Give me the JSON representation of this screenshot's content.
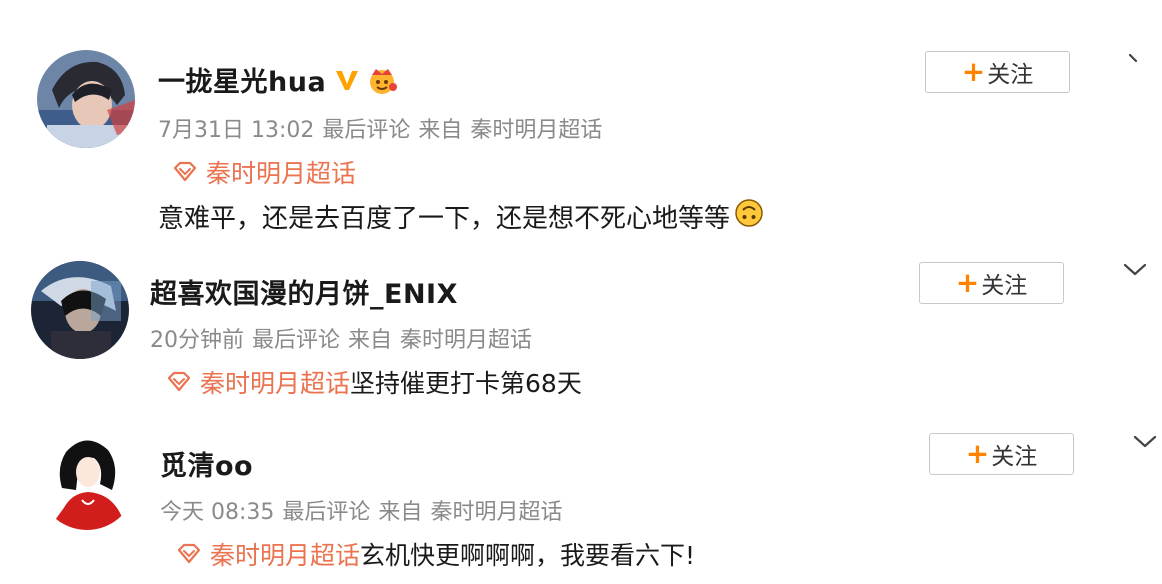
{
  "posts": [
    {
      "username": "一拢星光hua",
      "verified_icon": "orange-v-badge-icon",
      "level_icon": "crown-badge-icon",
      "time": "7月31日 13:02",
      "last_comment": "最后评论",
      "from_label": "来自",
      "source": "秦时明月超话",
      "topic": "秦时明月超话",
      "topic_text": "",
      "content": "意难平，还是去百度了一下，还是想不死心地等等",
      "content_emoji": "upside-down-face-icon",
      "follow_plus": "+",
      "follow_label": "关注"
    },
    {
      "username": "超喜欢国漫的月饼_ENIX",
      "time": "20分钟前",
      "last_comment": "最后评论",
      "from_label": "来自",
      "source": "秦时明月超话",
      "topic": "秦时明月超话",
      "topic_text": "坚持催更打卡第68天",
      "follow_plus": "+",
      "follow_label": "关注"
    },
    {
      "username": "觅清oo",
      "time": "今天 08:35",
      "last_comment": "最后评论",
      "from_label": "来自",
      "source": "秦时明月超话",
      "topic": "秦时明月超话",
      "topic_text": "玄机快更啊啊啊，我要看六下!",
      "follow_plus": "+",
      "follow_label": "关注"
    }
  ],
  "colors": {
    "topic": "#eb7350",
    "follow_plus": "#ff8200",
    "meta": "#8a8a8a"
  }
}
